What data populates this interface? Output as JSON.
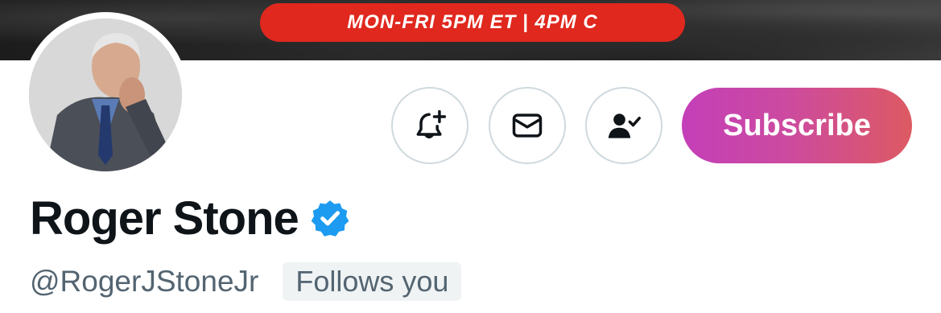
{
  "banner": {
    "text": "MON-FRI 5PM ET | 4PM C"
  },
  "profile": {
    "display_name": "Roger Stone",
    "handle": "@RogerJStoneJr",
    "follows_you_label": "Follows you",
    "verified": true
  },
  "actions": {
    "notify_icon": "bell-plus-icon",
    "message_icon": "envelope-icon",
    "following_icon": "person-check-icon",
    "subscribe_label": "Subscribe"
  },
  "colors": {
    "banner_pill": "#e0281e",
    "verified_badge": "#1d9bf0",
    "subscribe_gradient_start": "#c43fb8",
    "subscribe_gradient_end": "#dd5a62",
    "handle_text": "#536471"
  }
}
